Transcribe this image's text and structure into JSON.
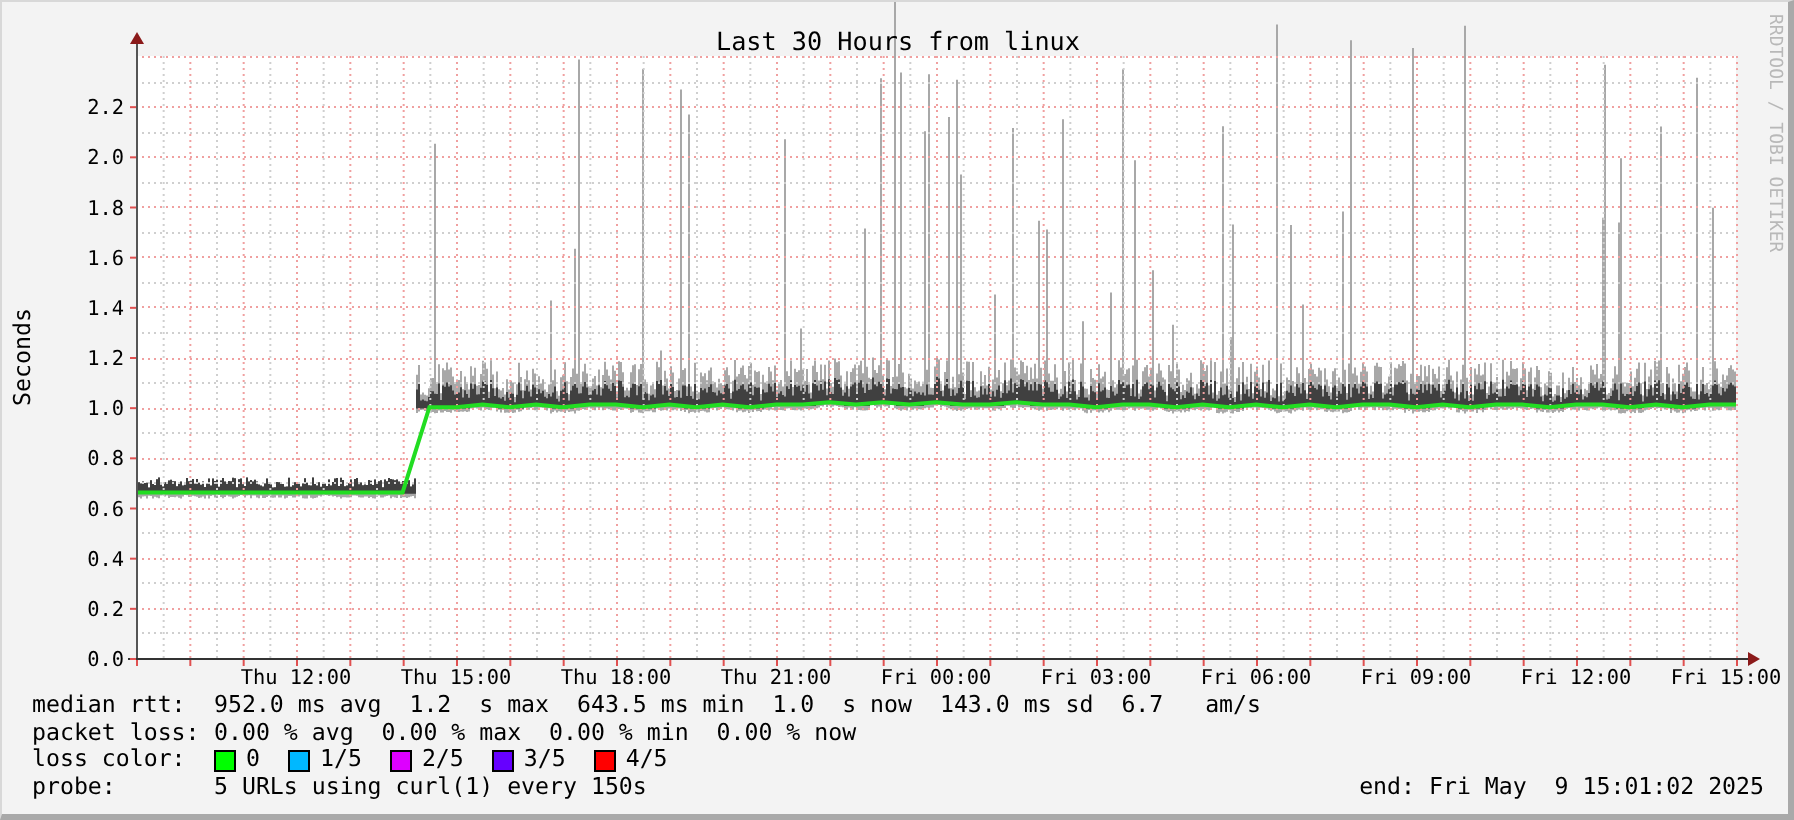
{
  "chart_data": {
    "type": "line",
    "title": "Last 30 Hours from linux",
    "ylabel": "Seconds",
    "ylim": [
      0,
      2.4
    ],
    "grid": true,
    "yticks": [
      {
        "value": 0,
        "label": "0.0"
      },
      {
        "value": 0.2,
        "label": "0.2"
      },
      {
        "value": 0.4,
        "label": "0.4"
      },
      {
        "value": 0.6,
        "label": "0.6"
      },
      {
        "value": 0.8,
        "label": "0.8"
      },
      {
        "value": 1.0,
        "label": "1.0"
      },
      {
        "value": 1.2,
        "label": "1.2"
      },
      {
        "value": 1.4,
        "label": "1.4"
      },
      {
        "value": 1.6,
        "label": "1.6"
      },
      {
        "value": 1.8,
        "label": "1.8"
      },
      {
        "value": 2.0,
        "label": "2.0"
      },
      {
        "value": 2.2,
        "label": "2.2"
      }
    ],
    "categories": [
      null,
      null,
      null,
      null,
      null,
      null,
      "Thu 12:00",
      null,
      null,
      null,
      null,
      null,
      "Thu 15:00",
      null,
      null,
      null,
      null,
      null,
      "Thu 18:00",
      null,
      null,
      null,
      null,
      null,
      "Thu 21:00",
      null,
      null,
      null,
      null,
      null,
      "Fri 00:00",
      null,
      null,
      null,
      null,
      null,
      "Fri 03:00",
      null,
      null,
      null,
      null,
      null,
      "Fri 06:00",
      null,
      null,
      null,
      null,
      null,
      "Fri 09:00",
      null,
      null,
      null,
      null,
      null,
      "Fri 12:00",
      null,
      null,
      null,
      null,
      null,
      "Fri 15:00"
    ],
    "series": [
      {
        "name": "median rtt:",
        "color": "#22dd22",
        "values": [
          0.66,
          0.66,
          0.66,
          0.66,
          0.66,
          0.66,
          0.66,
          0.66,
          0.66,
          0.66,
          0.66,
          1.0,
          1.0,
          1.01,
          1.0,
          1.01,
          1.0,
          1.01,
          1.01,
          1.0,
          1.01,
          1.0,
          1.01,
          1.0,
          1.01,
          1.01,
          1.02,
          1.01,
          1.02,
          1.01,
          1.02,
          1.01,
          1.01,
          1.02,
          1.01,
          1.01,
          1.0,
          1.01,
          1.01,
          1.0,
          1.01,
          1.0,
          1.01,
          1.0,
          1.01,
          1.0,
          1.01,
          1.01,
          1.0,
          1.01,
          1.0,
          1.01,
          1.01,
          1.0,
          1.01,
          1.01,
          1.0,
          1.01,
          1.0,
          1.01,
          1.01
        ]
      }
    ]
  },
  "credit": "RRDTOOL / TOBI OETIKER",
  "legend": {
    "rows": [
      {
        "text": "952.0 ms avg  1.2  s max  643.5 ms min  1.0  s now  143.0 ms sd  6.7   am/s"
      },
      {
        "label": "packet loss:",
        "text": "0.00 % avg  0.00 % max  0.00 % min  0.00 % now"
      }
    ],
    "loss_color": {
      "label": "loss color:",
      "items": [
        {
          "label": "0",
          "color": "#00ff00"
        },
        {
          "label": "1/5",
          "color": "#00b8ff"
        },
        {
          "label": "2/5",
          "color": "#dd00ff"
        },
        {
          "label": "3/5",
          "color": "#6600ff"
        },
        {
          "label": "4/5",
          "color": "#ff0000"
        }
      ]
    },
    "probe": {
      "label": "probe:",
      "text": "5 URLs using curl(1) every 150s"
    },
    "end": "end: Fri May  9 15:01:02 2025"
  }
}
